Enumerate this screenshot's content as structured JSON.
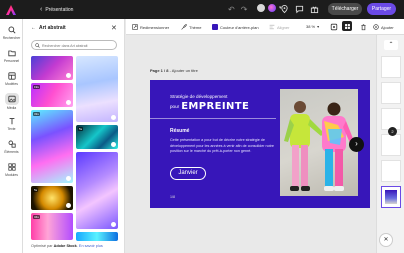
{
  "app": {
    "logo_icon": "adobe-express-logo",
    "back_label": "‹",
    "doc_title": "Présentation"
  },
  "topbar": {
    "undo_icon": "undo-icon",
    "redo_icon": "redo-icon",
    "download_label": "Télécharger",
    "share_label": "Partager",
    "accent": "#6b4ae6"
  },
  "rail": {
    "items": [
      {
        "label": "Rechercher",
        "icon": "search-icon"
      },
      {
        "label": "Personnel",
        "icon": "folder-icon"
      },
      {
        "label": "Modèles",
        "icon": "templates-icon"
      },
      {
        "label": "Média",
        "icon": "media-icon"
      },
      {
        "label": "Texte",
        "icon": "text-icon"
      },
      {
        "label": "Éléments",
        "icon": "shapes-icon"
      },
      {
        "label": "Modules",
        "icon": "addons-icon"
      }
    ],
    "active": "Média"
  },
  "panel": {
    "title": "Art abstrait",
    "search_placeholder": "Rechercher dans Art abstrait",
    "badges": [
      "19s",
      "5s",
      "33s",
      "5s",
      "34s"
    ],
    "footer_prefix": "Optimisé par ",
    "footer_brand": "Adobe Stock",
    "footer_sep": ". ",
    "footer_link": "En savoir plus"
  },
  "toolbar": {
    "redim_label": "Redimensionner",
    "theme_label": "Thème",
    "bg_color_label": "Couleur d'arrière-plan",
    "align_label": "Aligner",
    "zoom_label": "38 %",
    "add_page_label": "Ajouter"
  },
  "canvas": {
    "page_label_bold": "Page 1 / 8",
    "page_label_rest": " - Ajouter un titre"
  },
  "slide": {
    "bg_color": "#3716b9",
    "title_line1": "Stratégie de développement",
    "title_line2_prefix": "pour",
    "title_line2_brand": "EMPREINTE",
    "section_title": "Résumé",
    "body": "Cette présentation a pour but de décrire notre stratégie de développement pour les années à venir afin de consolider notre position sur le marché du prêt-à-porter non genré.",
    "pill_label": "Janvier",
    "page_number": "1/8"
  },
  "strip": {
    "up_icon": "chevron-up-icon",
    "close_icon": "close-icon",
    "badge": "2"
  }
}
